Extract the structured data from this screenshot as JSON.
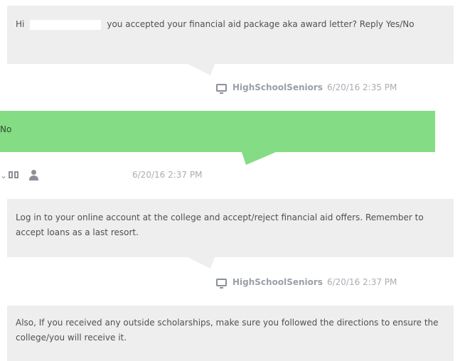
{
  "messages": [
    {
      "greeting": "Hi",
      "text": "you accepted your financial aid package aka award letter? Reply Yes/No",
      "sender": "HighSchoolSeniors",
      "timestamp": "6/20/16 2:35 PM"
    },
    {
      "text": "No",
      "timestamp": "6/20/16 2:37 PM",
      "bubble_color": "#84dc84"
    },
    {
      "text": "Log in to your online account at the college and accept/reject financial aid offers. Remember to accept loans as a last resort.",
      "sender": "HighSchoolSeniors",
      "timestamp": "6/20/16 2:37 PM"
    },
    {
      "text": "Also, If you received any outside scholarships, make sure you followed the directions to ensure the college/you will receive it."
    }
  ],
  "colors": {
    "incoming_bubble": "#eeeeee",
    "outgoing_bubble": "#84dc84",
    "meta_text": "#a9adb3"
  },
  "icons": [
    "sms-icon",
    "chevron-down-icon",
    "book-icon",
    "person-icon"
  ]
}
